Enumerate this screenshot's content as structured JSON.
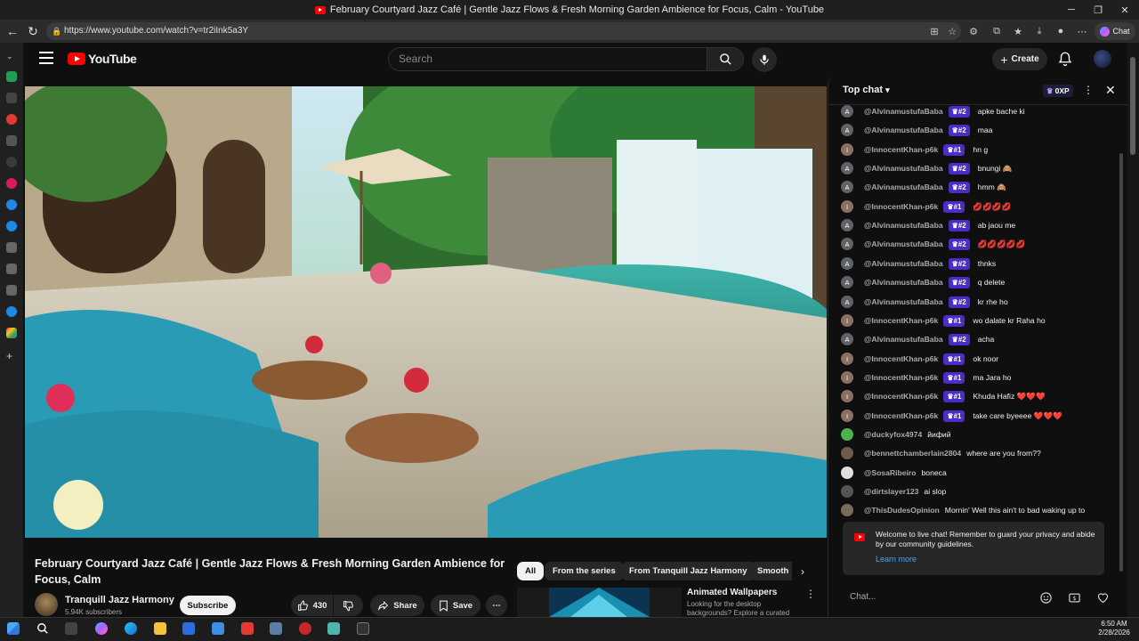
{
  "window": {
    "title": "February Courtyard Jazz Café | Gentle Jazz Flows & Fresh Morning Garden Ambience for Focus, Calm - YouTube"
  },
  "browser": {
    "url": "https://www.youtube.com/watch?v=tr2iInk5a3Y",
    "chat_label": "Chat"
  },
  "header": {
    "logo_text": "YouTube",
    "search_placeholder": "Search",
    "create_label": "Create"
  },
  "video": {
    "title": "February Courtyard Jazz Café | Gentle Jazz Flows & Fresh Morning Garden Ambience for Focus, Calm",
    "channel": "Tranquill Jazz Harmony",
    "subscribers": "5.94K subscribers",
    "subscribe_label": "Subscribe",
    "likes": "430",
    "share_label": "Share",
    "save_label": "Save"
  },
  "chips": [
    "All",
    "From the series",
    "From Tranquill Jazz Harmony",
    "Smooth"
  ],
  "recommendation": {
    "title": "Animated Wallpapers",
    "description": "Looking for the desktop backgrounds? Explore a curated"
  },
  "chat": {
    "header": "Top chat",
    "xp": "0XP",
    "messages": [
      {
        "initial": "A",
        "author": "@AlvinamustufaBaba",
        "badge": "#2",
        "text": "apke bache ki",
        "avatar_color": "#5f6368"
      },
      {
        "initial": "A",
        "author": "@AlvinamustufaBaba",
        "badge": "#2",
        "text": "maa",
        "avatar_color": "#5f6368"
      },
      {
        "initial": "I",
        "author": "@InnocentKhan-p6k",
        "badge": "#1",
        "text": "hn g",
        "avatar_color": "#8d6e63"
      },
      {
        "initial": "A",
        "author": "@AlvinamustufaBaba",
        "badge": "#2",
        "text": "bnungi 🙈",
        "avatar_color": "#5f6368"
      },
      {
        "initial": "A",
        "author": "@AlvinamustufaBaba",
        "badge": "#2",
        "text": "hmm 🙈",
        "avatar_color": "#5f6368"
      },
      {
        "initial": "I",
        "author": "@InnocentKhan-p6k",
        "badge": "#1",
        "text": "💋💋💋💋",
        "avatar_color": "#8d6e63"
      },
      {
        "initial": "A",
        "author": "@AlvinamustufaBaba",
        "badge": "#2",
        "text": "ab jaou me",
        "avatar_color": "#5f6368"
      },
      {
        "initial": "A",
        "author": "@AlvinamustufaBaba",
        "badge": "#2",
        "text": "💋💋💋💋💋",
        "avatar_color": "#5f6368"
      },
      {
        "initial": "A",
        "author": "@AlvinamustufaBaba",
        "badge": "#2",
        "text": "thnks",
        "avatar_color": "#5f6368"
      },
      {
        "initial": "A",
        "author": "@AlvinamustufaBaba",
        "badge": "#2",
        "text": "q delete",
        "avatar_color": "#5f6368"
      },
      {
        "initial": "A",
        "author": "@AlvinamustufaBaba",
        "badge": "#2",
        "text": "kr rhe ho",
        "avatar_color": "#5f6368"
      },
      {
        "initial": "I",
        "author": "@InnocentKhan-p6k",
        "badge": "#1",
        "text": "wo dalate kr Raha ho",
        "avatar_color": "#8d6e63"
      },
      {
        "initial": "A",
        "author": "@AlvinamustufaBaba",
        "badge": "#2",
        "text": "acha",
        "avatar_color": "#5f6368"
      },
      {
        "initial": "I",
        "author": "@InnocentKhan-p6k",
        "badge": "#1",
        "text": "ok noor",
        "avatar_color": "#8d6e63"
      },
      {
        "initial": "I",
        "author": "@InnocentKhan-p6k",
        "badge": "#1",
        "text": "ma Jara ho",
        "avatar_color": "#8d6e63"
      },
      {
        "initial": "I",
        "author": "@InnocentKhan-p6k",
        "badge": "#1",
        "text": "Khuda Hafiz ❤️❤️❤️",
        "avatar_color": "#8d6e63"
      },
      {
        "initial": "I",
        "author": "@InnocentKhan-p6k",
        "badge": "#1",
        "text": "take care byeeee ❤️❤️❤️",
        "avatar_color": "#8d6e63"
      },
      {
        "initial": "",
        "author": "@duckyfox4974",
        "badge": "",
        "text": "йифий",
        "avatar_color": "#4caf50"
      },
      {
        "initial": "",
        "author": "@bennettchamberlain2804",
        "badge": "",
        "text": "where are you from??",
        "avatar_color": "#6d5a4a"
      },
      {
        "initial": "",
        "author": "@SosaRibeiro",
        "badge": "",
        "text": "boneca",
        "avatar_color": "#e0e0e0"
      },
      {
        "initial": "",
        "author": "@dirtslayer123",
        "badge": "",
        "text": "ai slop",
        "avatar_color": "#555555"
      },
      {
        "initial": "",
        "author": "@ThisDudesOpinion",
        "badge": "",
        "text": "Mornin' Well this ain't to bad waking up to",
        "avatar_color": "#7a6a5a"
      }
    ],
    "welcome": "Welcome to live chat! Remember to guard your privacy and abide by our community guidelines.",
    "learn_more": "Learn more",
    "input_placeholder": "Chat..."
  },
  "taskbar": {
    "time": "6:50 AM",
    "date": "2/28/2026"
  },
  "colors": {
    "accent_red": "#ff0000",
    "badge_purple": "#4b2cc6",
    "link_blue": "#3ea6ff"
  }
}
